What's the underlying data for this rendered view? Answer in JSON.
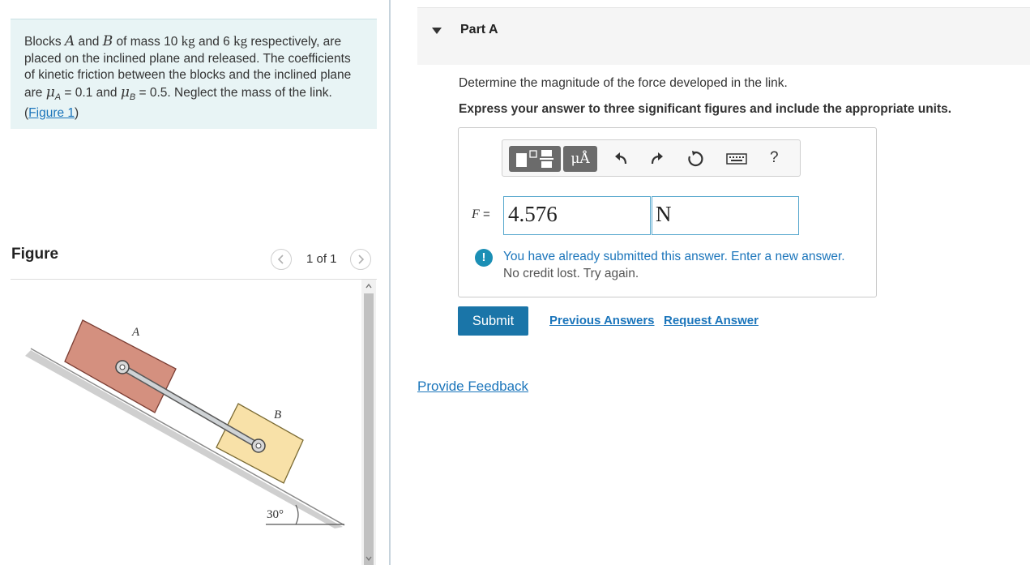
{
  "problem": {
    "seg1": "Blocks ",
    "blockA": "A",
    "seg2": " and ",
    "blockB": "B",
    "seg3": " of mass 10 ",
    "unitKg1": "kg",
    "seg4": " and 6 ",
    "unitKg2": "kg",
    "seg5": " respectively, are placed on the inclined plane and released. The coefficients of kinetic friction between the blocks and the inclined plane are ",
    "mu": "μ",
    "subA": "A",
    "seg6": " = 0.1 and ",
    "subB": "B",
    "seg7": " = 0.5. Neglect the mass of the link. (",
    "figureLink": "Figure 1",
    "seg8": ")"
  },
  "figurePanel": {
    "title": "Figure",
    "pageCount": "1 of 1",
    "labelA": "A",
    "labelB": "B",
    "angle": "30°"
  },
  "part": {
    "title": "Part A",
    "question": "Determine the magnitude of the force developed in the link.",
    "instruction": "Express your answer to three significant figures and include the appropriate units."
  },
  "toolbar": {
    "unitsLabel": "μÅ",
    "helpLabel": "?"
  },
  "answer": {
    "varName": "F",
    "equals": " =",
    "value": "4.576",
    "unit": "N"
  },
  "warning": {
    "icon": "!",
    "line1": "You have already submitted this answer. Enter a new answer.",
    "line2": "No credit lost. Try again."
  },
  "actions": {
    "submit": "Submit",
    "previousAnswers": "Previous Answers",
    "requestAnswer": "Request Answer",
    "feedback": "Provide Feedback"
  },
  "colors": {
    "accent": "#1b75bb",
    "submit": "#1a75a8",
    "blockA": "#d4907f",
    "blockB": "#f8e1a8"
  }
}
